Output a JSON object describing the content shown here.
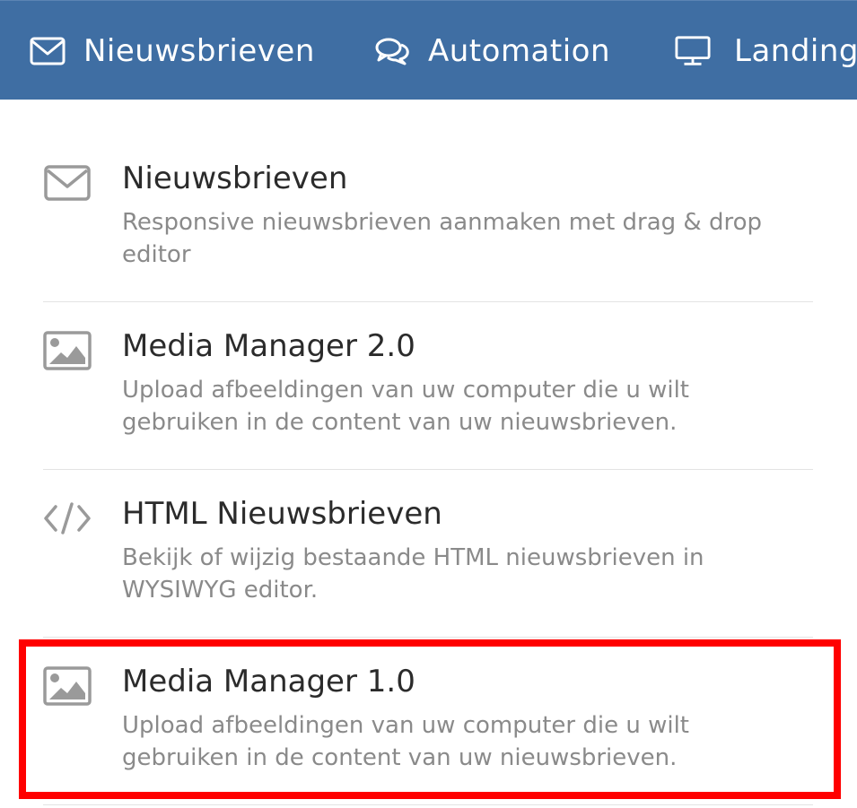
{
  "topnav": {
    "items": [
      {
        "label": "Nieuwsbrieven",
        "icon": "envelope-icon"
      },
      {
        "label": "Automation",
        "icon": "chat-bubbles-icon"
      },
      {
        "label": "Landing",
        "icon": "monitor-icon"
      }
    ]
  },
  "menu": {
    "items": [
      {
        "title": "Nieuwsbrieven",
        "description": "Responsive nieuwsbrieven aanmaken met drag & drop editor",
        "icon": "envelope-icon"
      },
      {
        "title": "Media Manager 2.0",
        "description": "Upload afbeeldingen van uw computer die u wilt gebruiken in de content van uw nieuwsbrieven.",
        "icon": "image-icon"
      },
      {
        "title": "HTML Nieuwsbrieven",
        "description": "Bekijk of wijzig bestaande HTML nieuwsbrieven in WYSIWYG editor.",
        "icon": "code-icon"
      },
      {
        "title": "Media Manager 1.0",
        "description": "Upload afbeeldingen van uw computer die u wilt gebruiken in de content van uw nieuwsbrieven.",
        "icon": "image-icon"
      }
    ]
  },
  "colors": {
    "nav_background": "#3f6ea3",
    "highlight": "#ff0000",
    "title_text": "#2b2b2b",
    "description_text": "#8a8a8a"
  }
}
